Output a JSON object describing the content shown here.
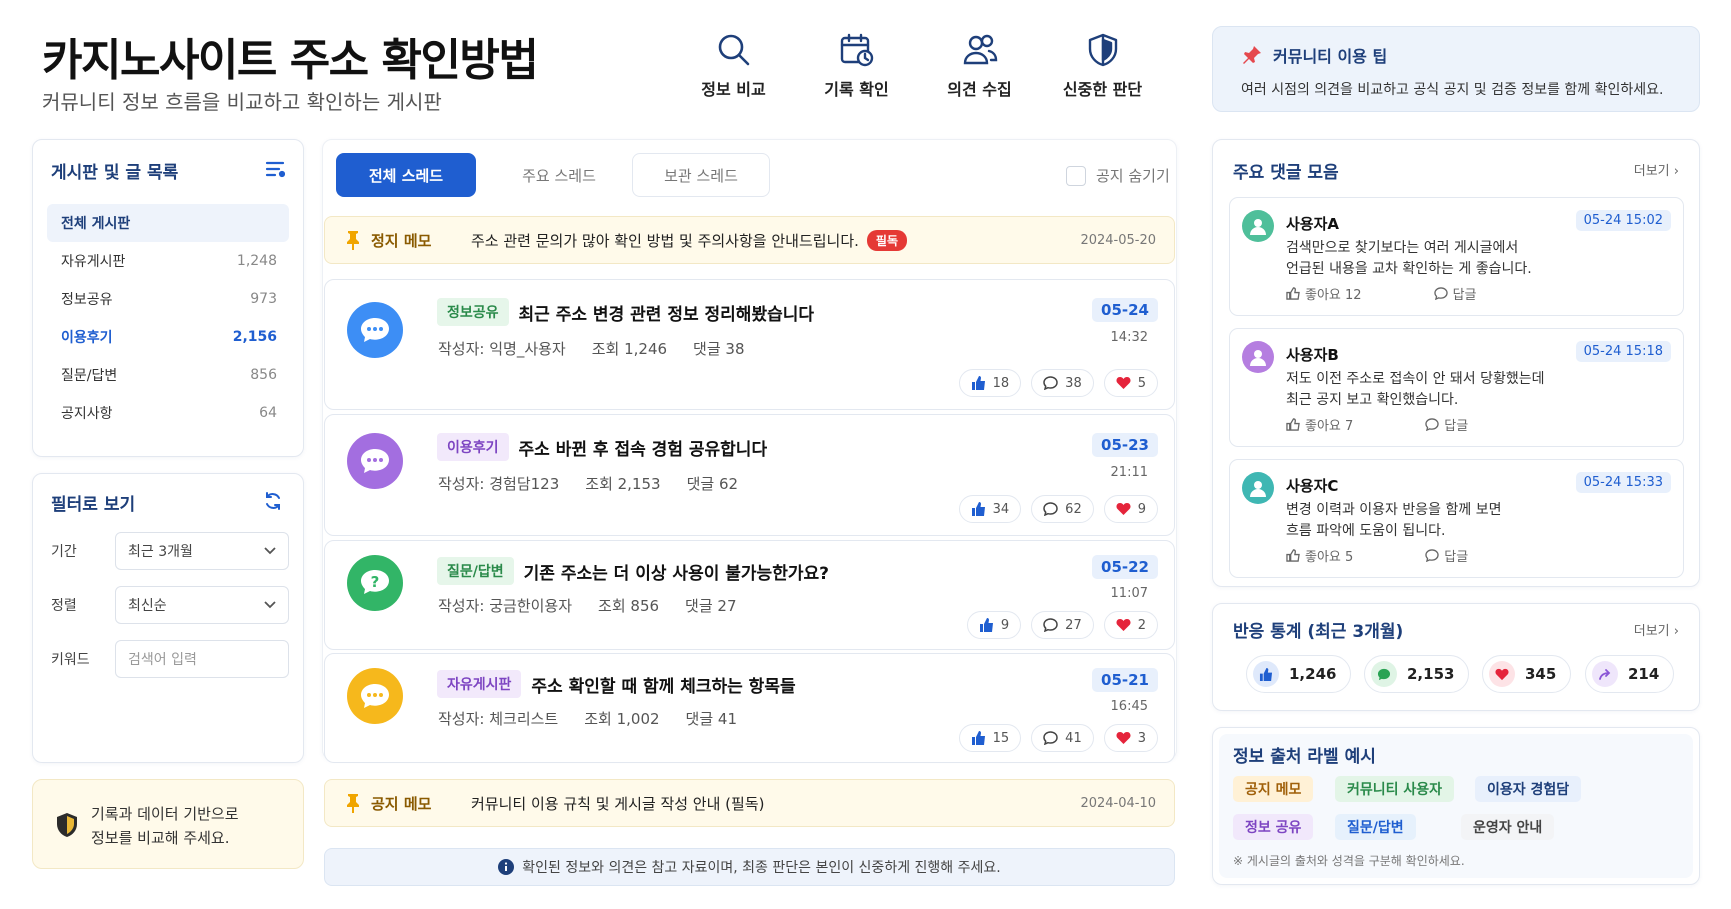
{
  "header": {
    "title": "카지노사이트 주소 확인방법",
    "subtitle": "커뮤니티 정보 흐름을 비교하고 확인하는 게시판"
  },
  "topnav": [
    {
      "label": "정보 비교",
      "icon": "search-icon"
    },
    {
      "label": "기록 확인",
      "icon": "calendar-clock-icon"
    },
    {
      "label": "의견 수집",
      "icon": "users-icon"
    },
    {
      "label": "신중한 판단",
      "icon": "shield-icon"
    }
  ],
  "tip": {
    "title": "커뮤니티 이용 팁",
    "text": "여러 시점의 의견을 비교하고 공식 공지 및 검증 정보를 함께 확인하세요."
  },
  "sidebar": {
    "title": "게시판 및 글 목록",
    "items": [
      {
        "label": "전체 게시판",
        "count": ""
      },
      {
        "label": "자유게시판",
        "count": "1,248"
      },
      {
        "label": "정보공유",
        "count": "973"
      },
      {
        "label": "이용후기",
        "count": "2,156"
      },
      {
        "label": "질문/답변",
        "count": "856"
      },
      {
        "label": "공지사항",
        "count": "64"
      }
    ]
  },
  "filter": {
    "title": "필터로 보기",
    "period_label": "기간",
    "period_value": "최근 3개월",
    "sort_label": "정렬",
    "sort_value": "최신순",
    "keyword_label": "키워드",
    "keyword_placeholder": "검색어 입력"
  },
  "tipbox": {
    "line1": "기록과 데이터 기반으로",
    "line2": "정보를 비교해 주세요."
  },
  "tabs": {
    "all": "전체 스레드",
    "main": "주요 스레드",
    "archive": "보관 스레드",
    "hide_notice": "공지 숨기기"
  },
  "notice1": {
    "label": "정지 메모",
    "text": "주소 관련 문의가 많아 확인 방법 및 주의사항을 안내드립니다.",
    "badge": "필독",
    "date": "2024-05-20"
  },
  "notice2": {
    "label": "공지 메모",
    "text": "커뮤니티 이용 규칙 및 게시글 작성 안내 (필독)",
    "date": "2024-04-10"
  },
  "posts": [
    {
      "tag": "정보공유",
      "title": "최근 주소 변경 관련 정보 정리해봤습니다",
      "author": "작성자: 익명_사용자",
      "views": "조회 1,246",
      "comments": "댓글 38",
      "date": "05-24",
      "time": "14:32",
      "likes": "18",
      "replies": "38",
      "hearts": "5",
      "color": "#3d8ef5"
    },
    {
      "tag": "이용후기",
      "title": "주소 바뀐 후 접속 경험 공유합니다",
      "author": "작성자: 경험담123",
      "views": "조회 2,153",
      "comments": "댓글 62",
      "date": "05-23",
      "time": "21:11",
      "likes": "34",
      "replies": "62",
      "hearts": "9",
      "color": "#a36ee0"
    },
    {
      "tag": "질문/답변",
      "title": "기존 주소는 더 이상 사용이 불가능한가요?",
      "author": "작성자: 궁금한이용자",
      "views": "조회 856",
      "comments": "댓글 27",
      "date": "05-22",
      "time": "11:07",
      "likes": "9",
      "replies": "27",
      "hearts": "2",
      "color": "#32b567"
    },
    {
      "tag": "자유게시판",
      "title": "주소 확인할 때 함께 체크하는 항목들",
      "author": "작성자: 체크리스트",
      "views": "조회 1,002",
      "comments": "댓글 41",
      "date": "05-21",
      "time": "16:45",
      "likes": "15",
      "replies": "41",
      "hearts": "3",
      "color": "#f6b81c"
    }
  ],
  "footnote": "확인된 정보와 의견은 참고 자료이며, 최종 판단은 본인이 신중하게 진행해 주세요.",
  "comments": {
    "title": "주요 댓글 모음",
    "more": "더보기",
    "items": [
      {
        "name": "사용자A",
        "date": "05-24 15:02",
        "line1": "검색만으로 찾기보다는 여러 게시글에서",
        "line2": "언급된 내용을 교차 확인하는 게 좋습니다.",
        "likes": "좋아요 12",
        "reply": "답글",
        "color": "#4fbf9a"
      },
      {
        "name": "사용자B",
        "date": "05-24 15:18",
        "line1": "저도 이전 주소로 접속이 안 돼서 당황했는데",
        "line2": "최근 공지 보고 확인했습니다.",
        "likes": "좋아요 7",
        "reply": "답글",
        "color": "#b57ee0"
      },
      {
        "name": "사용자C",
        "date": "05-24 15:33",
        "line1": "변경 이력과 이용자 반응을 함께 보면",
        "line2": "흐름 파악에 도움이 됩니다.",
        "likes": "좋아요 5",
        "reply": "답글",
        "color": "#3fb7b3"
      }
    ]
  },
  "stats": {
    "title": "반응 통계 (최근 3개월)",
    "more": "더보기",
    "likes": "1,246",
    "comments": "2,153",
    "hearts": "345",
    "shares": "214"
  },
  "labels": {
    "title": "정보 출처 라벨 예시",
    "items": [
      "공지 메모",
      "커뮤니티 사용자",
      "이용자 경험담",
      "정보 공유",
      "질문/답변",
      "운영자 안내"
    ],
    "note": "※ 게시글의 출처와 성격을 구분해 확인하세요."
  }
}
